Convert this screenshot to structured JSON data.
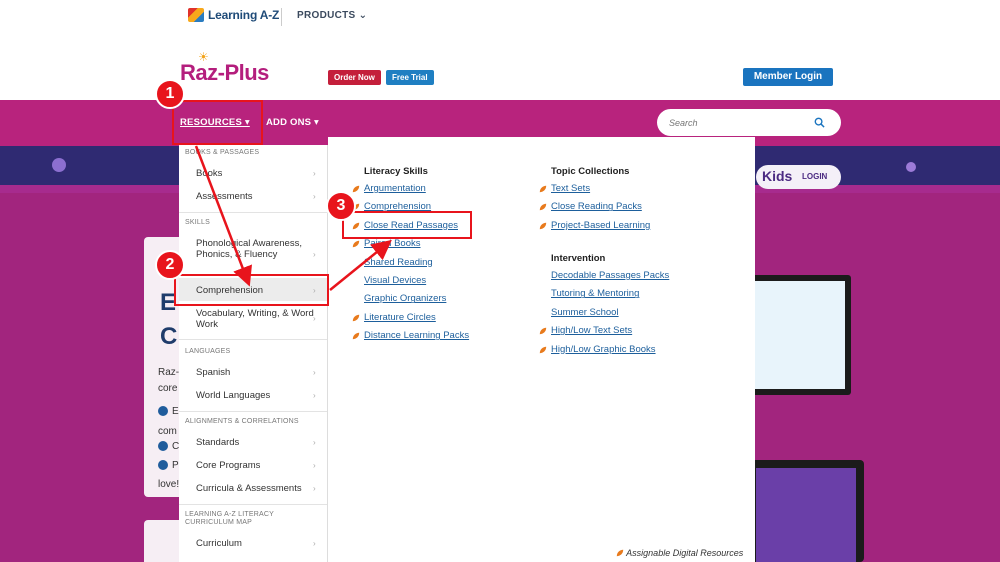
{
  "topbar": {
    "logo_text": "Learning A-Z",
    "products_label": "PRODUCTS"
  },
  "brand": {
    "logo_text": "Raz-Plus",
    "order_now": "Order Now",
    "free_trial": "Free Trial",
    "member_login": "Member Login"
  },
  "nav": {
    "resources": "RESOURCES",
    "add_ons": "ADD ONS",
    "search_placeholder": "Search"
  },
  "banner": {
    "kids": "Kids",
    "login": "LOGIN"
  },
  "hero": {
    "big1": "E",
    "big2": "Cl",
    "small1": "Raz-",
    "small2": "core",
    "b1": "Ea",
    "b1b": "com",
    "b2": "C",
    "b3": "P",
    "b3b": "love!"
  },
  "menu": {
    "sections": [
      {
        "heading": "BOOKS & PASSAGES",
        "items": [
          "Books",
          "Assessments"
        ]
      },
      {
        "heading": "SKILLS",
        "items": [
          "Phonological Awareness, Phonics, & Fluency",
          "Comprehension",
          "Vocabulary, Writing, & Word Work"
        ]
      },
      {
        "heading": "LANGUAGES",
        "items": [
          "Spanish",
          "World Languages"
        ]
      },
      {
        "heading": "ALIGNMENTS & CORRELATIONS",
        "items": [
          "Standards",
          "Core Programs",
          "Curricula & Assessments"
        ]
      },
      {
        "heading": "LEARNING A-Z LITERACY CURRICULUM MAP",
        "items": [
          "Curriculum"
        ]
      }
    ],
    "literacy_skills": {
      "title": "Literacy Skills",
      "links": [
        "Argumentation",
        "Comprehension",
        "Close Read Passages",
        "Paired Books",
        "Shared Reading",
        "Visual Devices",
        "Graphic Organizers",
        "Literature Circles",
        "Distance Learning Packs"
      ]
    },
    "topic_collections": {
      "title": "Topic Collections",
      "links": [
        "Text Sets",
        "Close Reading Packs",
        "Project-Based Learning"
      ]
    },
    "intervention": {
      "title": "Intervention",
      "links": [
        "Decodable Passages Packs",
        "Tutoring & Mentoring",
        "Summer School",
        "High/Low Text Sets",
        "High/Low Graphic Books"
      ]
    },
    "footer_note": "Assignable Digital Resources"
  },
  "annotations": {
    "step1": "1",
    "step2": "2",
    "step3": "3"
  },
  "colors": {
    "brand_magenta": "#b8237d",
    "link_blue": "#1d5f9c",
    "annotation_red": "#e8141c",
    "leaf_orange": "#e87a1c"
  }
}
